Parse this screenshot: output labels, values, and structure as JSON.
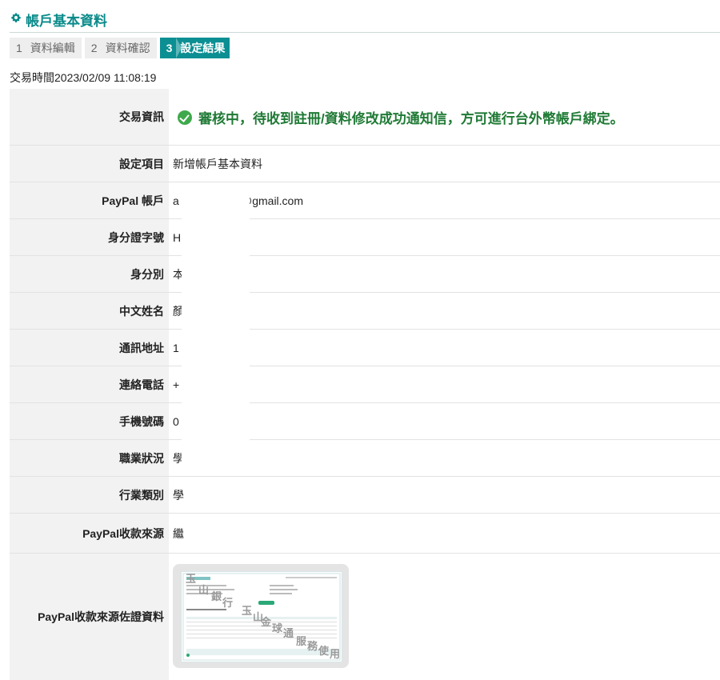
{
  "header": {
    "title": "帳戶基本資料",
    "icon": "gear-icon"
  },
  "steps": [
    {
      "num": "1",
      "label": "資料編輯"
    },
    {
      "num": "2",
      "label": "資料確認"
    },
    {
      "num": "3",
      "label": "設定結果"
    }
  ],
  "transaction_time": "交易時間2023/02/09 11:08:19",
  "status": {
    "label": "交易資訊",
    "message": "審核中，待收到註冊/資料修改成功通知信，方可進行台外幣帳戶綁定。"
  },
  "rows": [
    {
      "label": "設定項目",
      "value": "新增帳戶基本資料"
    },
    {
      "label": "PayPal 帳戶",
      "value": "a",
      "value2": "@gmail.com"
    },
    {
      "label": "身分證字號",
      "value": "H"
    },
    {
      "label": "身分別",
      "value": "本"
    },
    {
      "label": "中文姓名",
      "value": "顏"
    },
    {
      "label": "通訊地址",
      "value": "1"
    },
    {
      "label": "連絡電話",
      "value": "+"
    },
    {
      "label": "手機號碼",
      "value": "0"
    },
    {
      "label": "職業狀況",
      "value": "學"
    },
    {
      "label": "行業類別",
      "value": "學"
    },
    {
      "label": "PayPal收款來源",
      "value": "繼"
    },
    {
      "label": "PayPal收款來源佐證資料"
    }
  ],
  "proof_watermark": [
    "玉",
    "山",
    "銀",
    "行",
    "玉",
    "山",
    "金",
    "球",
    "通",
    "服",
    "務",
    "使",
    "用"
  ],
  "colors": {
    "accent": "#0b8f93",
    "title": "#0a8a8a",
    "success": "#3ea94b",
    "status_text": "#1f7a35",
    "label_bg": "#f2f2f2"
  }
}
